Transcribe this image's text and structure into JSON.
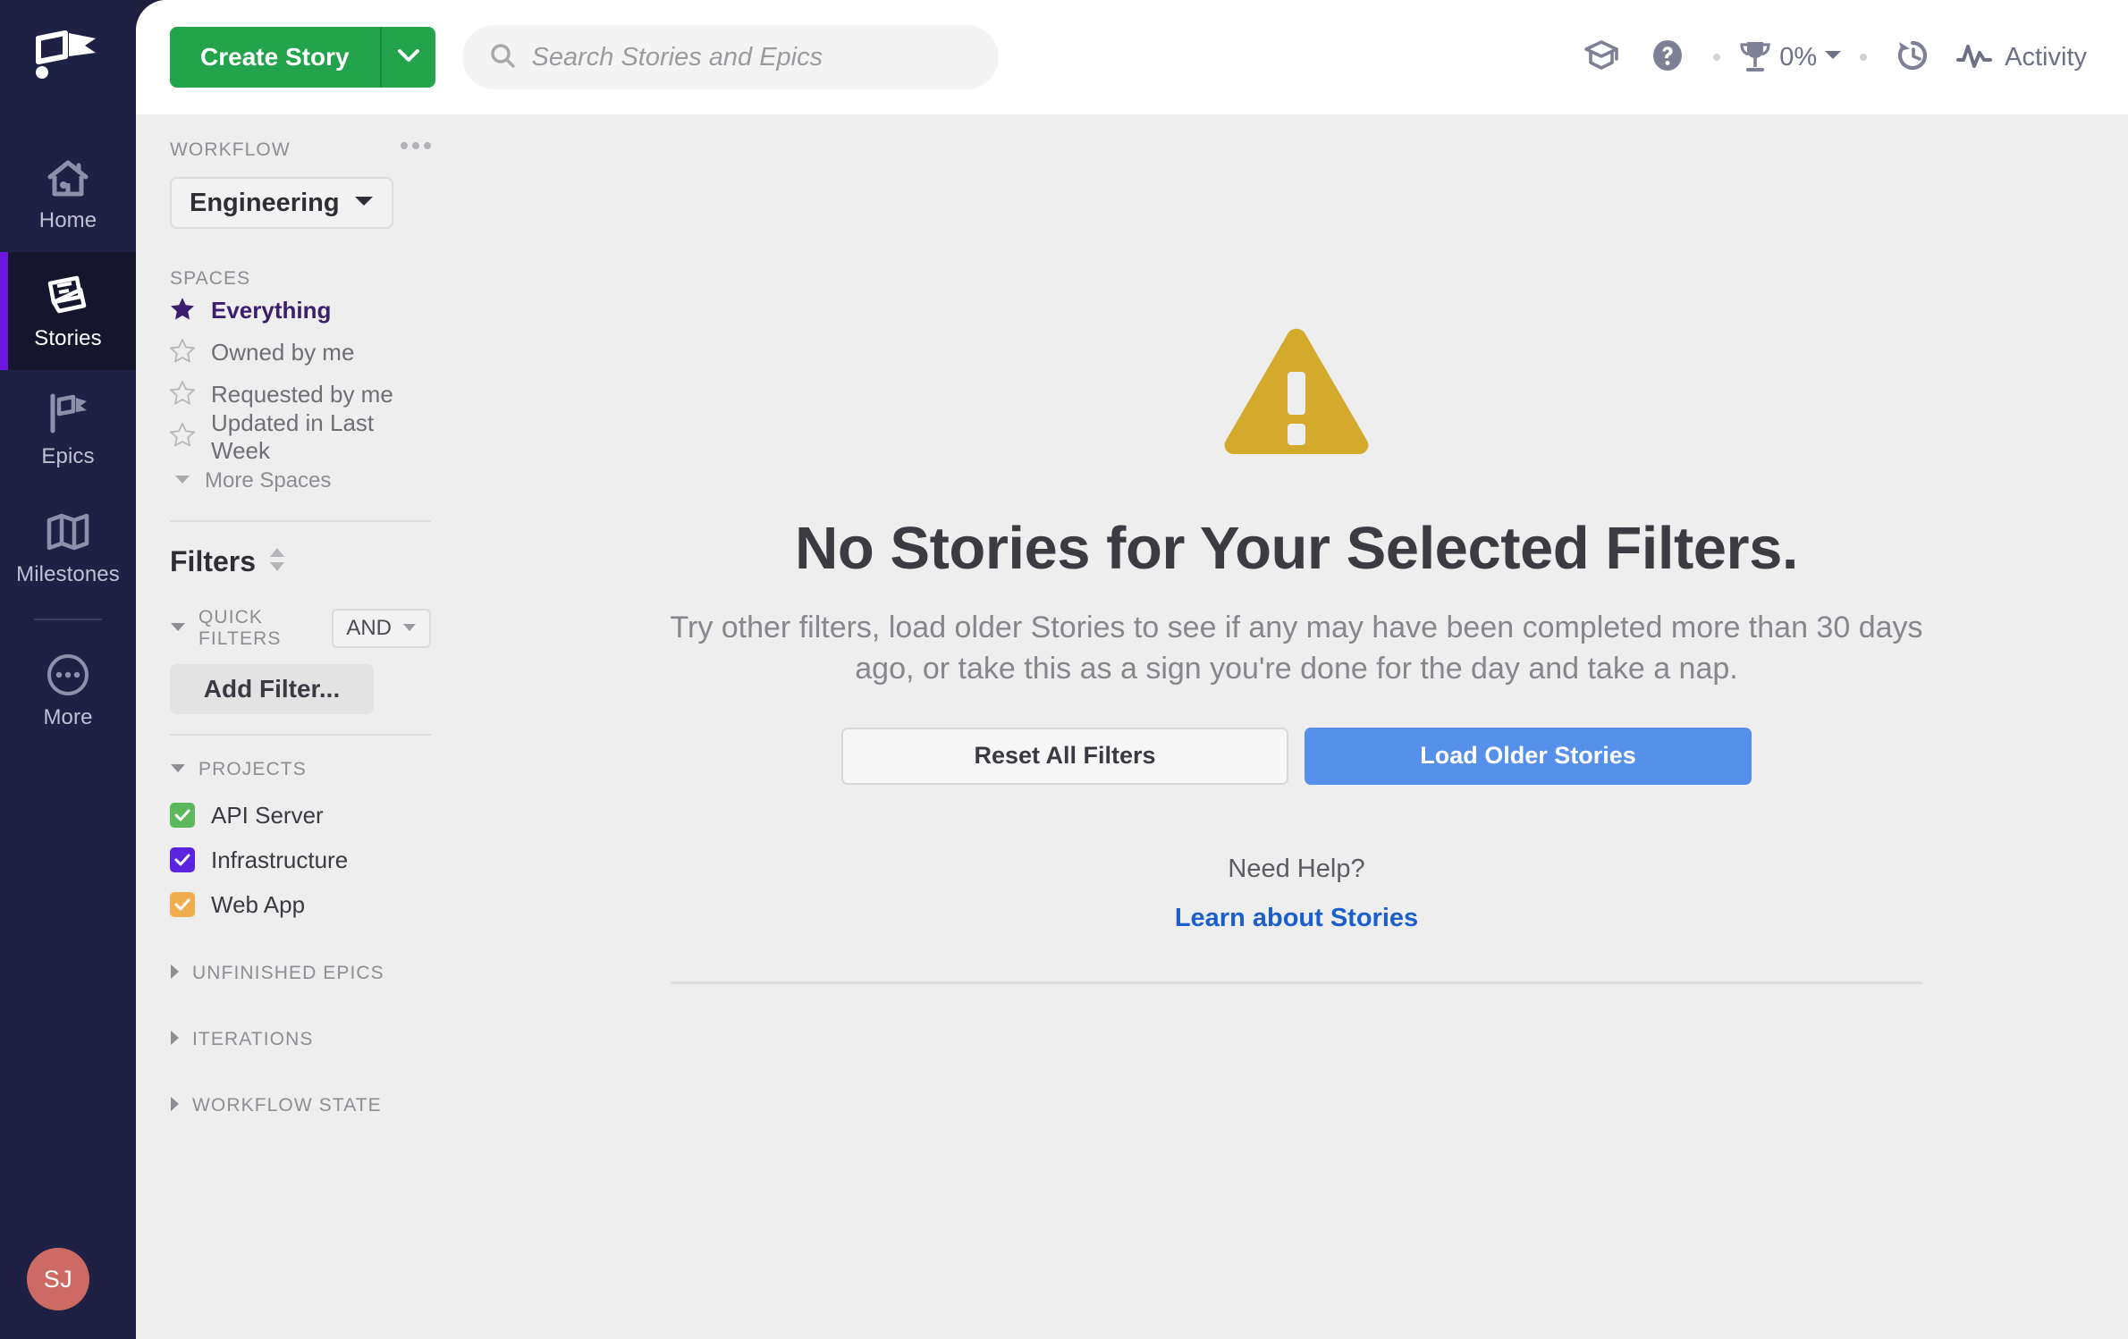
{
  "rail": {
    "logo_icon": "clubhouse-flag-logo",
    "items": [
      {
        "label": "Home",
        "icon": "home-icon",
        "active": false
      },
      {
        "label": "Stories",
        "icon": "stories-icon",
        "active": true
      },
      {
        "label": "Epics",
        "icon": "epics-flag-icon",
        "active": false
      },
      {
        "label": "Milestones",
        "icon": "milestones-map-icon",
        "active": false
      },
      {
        "label": "More",
        "icon": "more-ellipsis-circle-icon",
        "active": false
      }
    ],
    "avatar_initials": "SJ",
    "avatar_color": "#cd6a63",
    "active_indicator_color": "#6b17e0"
  },
  "topbar": {
    "create_label": "Create Story",
    "create_color": "#22a34c",
    "create_caret_icon": "chevron-down-icon",
    "search": {
      "placeholder": "Search Stories and Epics",
      "value": "",
      "icon": "search-icon"
    },
    "learn_icon": "graduation-cap-icon",
    "help_icon": "question-circle-icon",
    "trophy": {
      "icon": "trophy-icon",
      "percent": "0%",
      "caret_icon": "caret-down-icon"
    },
    "history_icon": "history-clock-icon",
    "activity": {
      "icon": "activity-pulse-icon",
      "label": "Activity"
    }
  },
  "panel": {
    "workflow_label": "WORKFLOW",
    "kebab_icon": "more-options-icon",
    "workflow_value": "Engineering",
    "workflow_caret_icon": "caret-down-icon",
    "spaces_label": "SPACES",
    "spaces": [
      {
        "label": "Everything",
        "icon": "star-filled-icon",
        "selected": true
      },
      {
        "label": "Owned by me",
        "icon": "star-outline-icon",
        "selected": false
      },
      {
        "label": "Requested by me",
        "icon": "star-outline-icon",
        "selected": false
      },
      {
        "label": "Updated in Last Week",
        "icon": "star-outline-icon",
        "selected": false
      }
    ],
    "more_spaces_label": "More Spaces",
    "more_spaces_caret_icon": "caret-down-icon",
    "filters_title": "Filters",
    "filters_sort_icon": "sort-updown-icon",
    "quick_filters_label": "QUICK FILTERS",
    "quick_filters_caret_icon": "caret-down-icon",
    "and_value": "AND",
    "and_caret_icon": "caret-down-icon",
    "add_filter_label": "Add Filter...",
    "projects_label": "PROJECTS",
    "projects_caret_icon": "caret-down-icon",
    "projects": [
      {
        "label": "API Server",
        "checked": true,
        "color": "#5cb85c"
      },
      {
        "label": "Infrastructure",
        "checked": true,
        "color": "#5b25e0"
      },
      {
        "label": "Web App",
        "checked": true,
        "color": "#f0ad4e"
      }
    ],
    "collapsed_groups": [
      {
        "label": "UNFINISHED EPICS",
        "caret_icon": "caret-right-icon"
      },
      {
        "label": "ITERATIONS",
        "caret_icon": "caret-right-icon"
      },
      {
        "label": "WORKFLOW STATE",
        "caret_icon": "caret-right-icon"
      }
    ]
  },
  "main": {
    "warning_icon": "warning-triangle-icon",
    "warning_color": "#d3aa2b",
    "title": "No Stories for Your Selected Filters.",
    "subtitle": "Try other filters, load older Stories to see if any may have been completed more than 30 days ago, or take this as a sign you're done for the day and take a nap.",
    "reset_label": "Reset All Filters",
    "load_label": "Load Older Stories",
    "load_color": "#5590ea",
    "need_help": "Need Help?",
    "learn_link": "Learn about Stories",
    "learn_link_color": "#1a5fcb"
  }
}
